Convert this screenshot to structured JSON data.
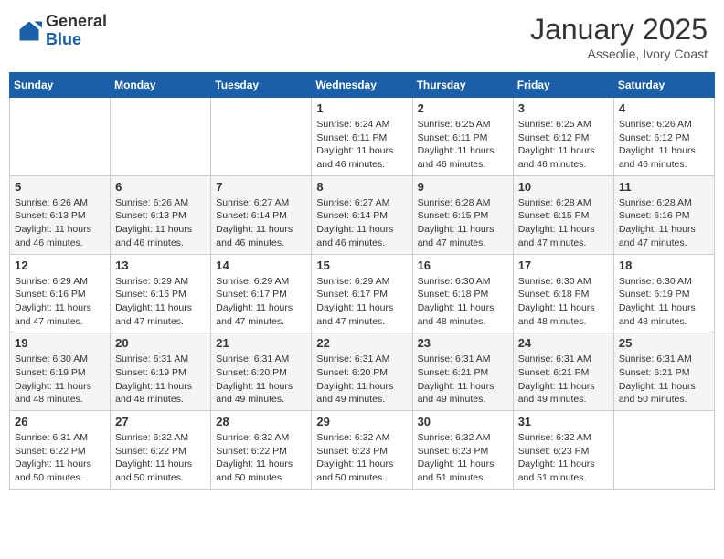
{
  "header": {
    "logo_general": "General",
    "logo_blue": "Blue",
    "month_title": "January 2025",
    "location": "Asseolie, Ivory Coast"
  },
  "weekdays": [
    "Sunday",
    "Monday",
    "Tuesday",
    "Wednesday",
    "Thursday",
    "Friday",
    "Saturday"
  ],
  "weeks": [
    [
      {
        "day": "",
        "sunrise": "",
        "sunset": "",
        "daylight": ""
      },
      {
        "day": "",
        "sunrise": "",
        "sunset": "",
        "daylight": ""
      },
      {
        "day": "",
        "sunrise": "",
        "sunset": "",
        "daylight": ""
      },
      {
        "day": "1",
        "sunrise": "Sunrise: 6:24 AM",
        "sunset": "Sunset: 6:11 PM",
        "daylight": "Daylight: 11 hours and 46 minutes."
      },
      {
        "day": "2",
        "sunrise": "Sunrise: 6:25 AM",
        "sunset": "Sunset: 6:11 PM",
        "daylight": "Daylight: 11 hours and 46 minutes."
      },
      {
        "day": "3",
        "sunrise": "Sunrise: 6:25 AM",
        "sunset": "Sunset: 6:12 PM",
        "daylight": "Daylight: 11 hours and 46 minutes."
      },
      {
        "day": "4",
        "sunrise": "Sunrise: 6:26 AM",
        "sunset": "Sunset: 6:12 PM",
        "daylight": "Daylight: 11 hours and 46 minutes."
      }
    ],
    [
      {
        "day": "5",
        "sunrise": "Sunrise: 6:26 AM",
        "sunset": "Sunset: 6:13 PM",
        "daylight": "Daylight: 11 hours and 46 minutes."
      },
      {
        "day": "6",
        "sunrise": "Sunrise: 6:26 AM",
        "sunset": "Sunset: 6:13 PM",
        "daylight": "Daylight: 11 hours and 46 minutes."
      },
      {
        "day": "7",
        "sunrise": "Sunrise: 6:27 AM",
        "sunset": "Sunset: 6:14 PM",
        "daylight": "Daylight: 11 hours and 46 minutes."
      },
      {
        "day": "8",
        "sunrise": "Sunrise: 6:27 AM",
        "sunset": "Sunset: 6:14 PM",
        "daylight": "Daylight: 11 hours and 46 minutes."
      },
      {
        "day": "9",
        "sunrise": "Sunrise: 6:28 AM",
        "sunset": "Sunset: 6:15 PM",
        "daylight": "Daylight: 11 hours and 47 minutes."
      },
      {
        "day": "10",
        "sunrise": "Sunrise: 6:28 AM",
        "sunset": "Sunset: 6:15 PM",
        "daylight": "Daylight: 11 hours and 47 minutes."
      },
      {
        "day": "11",
        "sunrise": "Sunrise: 6:28 AM",
        "sunset": "Sunset: 6:16 PM",
        "daylight": "Daylight: 11 hours and 47 minutes."
      }
    ],
    [
      {
        "day": "12",
        "sunrise": "Sunrise: 6:29 AM",
        "sunset": "Sunset: 6:16 PM",
        "daylight": "Daylight: 11 hours and 47 minutes."
      },
      {
        "day": "13",
        "sunrise": "Sunrise: 6:29 AM",
        "sunset": "Sunset: 6:16 PM",
        "daylight": "Daylight: 11 hours and 47 minutes."
      },
      {
        "day": "14",
        "sunrise": "Sunrise: 6:29 AM",
        "sunset": "Sunset: 6:17 PM",
        "daylight": "Daylight: 11 hours and 47 minutes."
      },
      {
        "day": "15",
        "sunrise": "Sunrise: 6:29 AM",
        "sunset": "Sunset: 6:17 PM",
        "daylight": "Daylight: 11 hours and 47 minutes."
      },
      {
        "day": "16",
        "sunrise": "Sunrise: 6:30 AM",
        "sunset": "Sunset: 6:18 PM",
        "daylight": "Daylight: 11 hours and 48 minutes."
      },
      {
        "day": "17",
        "sunrise": "Sunrise: 6:30 AM",
        "sunset": "Sunset: 6:18 PM",
        "daylight": "Daylight: 11 hours and 48 minutes."
      },
      {
        "day": "18",
        "sunrise": "Sunrise: 6:30 AM",
        "sunset": "Sunset: 6:19 PM",
        "daylight": "Daylight: 11 hours and 48 minutes."
      }
    ],
    [
      {
        "day": "19",
        "sunrise": "Sunrise: 6:30 AM",
        "sunset": "Sunset: 6:19 PM",
        "daylight": "Daylight: 11 hours and 48 minutes."
      },
      {
        "day": "20",
        "sunrise": "Sunrise: 6:31 AM",
        "sunset": "Sunset: 6:19 PM",
        "daylight": "Daylight: 11 hours and 48 minutes."
      },
      {
        "day": "21",
        "sunrise": "Sunrise: 6:31 AM",
        "sunset": "Sunset: 6:20 PM",
        "daylight": "Daylight: 11 hours and 49 minutes."
      },
      {
        "day": "22",
        "sunrise": "Sunrise: 6:31 AM",
        "sunset": "Sunset: 6:20 PM",
        "daylight": "Daylight: 11 hours and 49 minutes."
      },
      {
        "day": "23",
        "sunrise": "Sunrise: 6:31 AM",
        "sunset": "Sunset: 6:21 PM",
        "daylight": "Daylight: 11 hours and 49 minutes."
      },
      {
        "day": "24",
        "sunrise": "Sunrise: 6:31 AM",
        "sunset": "Sunset: 6:21 PM",
        "daylight": "Daylight: 11 hours and 49 minutes."
      },
      {
        "day": "25",
        "sunrise": "Sunrise: 6:31 AM",
        "sunset": "Sunset: 6:21 PM",
        "daylight": "Daylight: 11 hours and 50 minutes."
      }
    ],
    [
      {
        "day": "26",
        "sunrise": "Sunrise: 6:31 AM",
        "sunset": "Sunset: 6:22 PM",
        "daylight": "Daylight: 11 hours and 50 minutes."
      },
      {
        "day": "27",
        "sunrise": "Sunrise: 6:32 AM",
        "sunset": "Sunset: 6:22 PM",
        "daylight": "Daylight: 11 hours and 50 minutes."
      },
      {
        "day": "28",
        "sunrise": "Sunrise: 6:32 AM",
        "sunset": "Sunset: 6:22 PM",
        "daylight": "Daylight: 11 hours and 50 minutes."
      },
      {
        "day": "29",
        "sunrise": "Sunrise: 6:32 AM",
        "sunset": "Sunset: 6:23 PM",
        "daylight": "Daylight: 11 hours and 50 minutes."
      },
      {
        "day": "30",
        "sunrise": "Sunrise: 6:32 AM",
        "sunset": "Sunset: 6:23 PM",
        "daylight": "Daylight: 11 hours and 51 minutes."
      },
      {
        "day": "31",
        "sunrise": "Sunrise: 6:32 AM",
        "sunset": "Sunset: 6:23 PM",
        "daylight": "Daylight: 11 hours and 51 minutes."
      },
      {
        "day": "",
        "sunrise": "",
        "sunset": "",
        "daylight": ""
      }
    ]
  ]
}
